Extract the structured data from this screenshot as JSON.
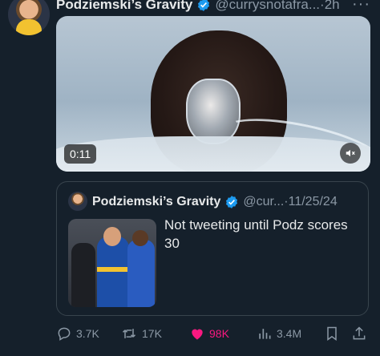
{
  "author": {
    "display_name": "Podziemski’s Gravity",
    "handle": "@currysnotafra...",
    "separator": "·",
    "time": "2h",
    "more": "···"
  },
  "video": {
    "duration": "0:11",
    "muted": true
  },
  "quoted": {
    "display_name": "Podziemski’s Gravity",
    "handle": "@cur...",
    "separator": "·",
    "date": "11/25/24",
    "text": "Not tweeting until Podz scores 30"
  },
  "actions": {
    "replies": "3.7K",
    "retweets": "17K",
    "likes": "98K",
    "views": "3.4M"
  },
  "colors": {
    "background": "#15202b",
    "verified": "#1d9bf0",
    "like": "#f91880",
    "muted_text": "#8b98a5"
  }
}
